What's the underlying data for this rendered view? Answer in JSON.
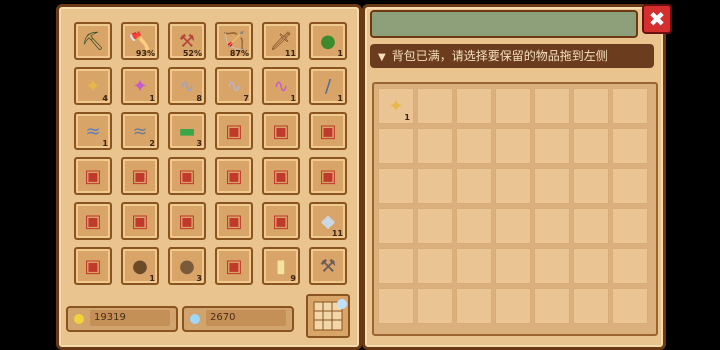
{
  "notice": {
    "text": "背包已满，请选择要保留的物品拖到左侧"
  },
  "close": {
    "symbol": "✖"
  },
  "currency": {
    "gold": "19319",
    "gem": "2670",
    "gold_color": "#f2d23a",
    "gem_color": "#9fd8ff"
  },
  "left_items": [
    {
      "icon": "pickaxe-icon",
      "glyph": "⛏",
      "color": "#2f4a22",
      "count": ""
    },
    {
      "icon": "axe-icon",
      "glyph": "🪓",
      "color": "#c9463a",
      "count": "93%"
    },
    {
      "icon": "hoe-icon",
      "glyph": "⚒",
      "color": "#b4473c",
      "count": "52%"
    },
    {
      "icon": "bow-icon",
      "glyph": "🏹",
      "color": "#b97a3c",
      "count": "87%"
    },
    {
      "icon": "sword-icon",
      "glyph": "🗡",
      "color": "#7a4a22",
      "count": "11"
    },
    {
      "icon": "melon-icon",
      "glyph": "●",
      "color": "#3b8a2c",
      "count": "1"
    },
    {
      "icon": "wand-star-icon",
      "glyph": "✦",
      "color": "#e6b84a",
      "count": "4"
    },
    {
      "icon": "wand-purple-icon",
      "glyph": "✦",
      "color": "#c85ad0",
      "count": "1"
    },
    {
      "icon": "hook-icon",
      "glyph": "∿",
      "color": "#9aa3c8",
      "count": "8"
    },
    {
      "icon": "hook-icon",
      "glyph": "∿",
      "color": "#b6b6d6",
      "count": "7"
    },
    {
      "icon": "hook-star-icon",
      "glyph": "∿",
      "color": "#c85ad0",
      "count": "1"
    },
    {
      "icon": "fish-rod-icon",
      "glyph": "/",
      "color": "#4a6aa0",
      "count": "1"
    },
    {
      "icon": "fish-icon",
      "glyph": "≈",
      "color": "#5c7fc0",
      "count": "1"
    },
    {
      "icon": "fish-icon",
      "glyph": "≈",
      "color": "#6c7e96",
      "count": "2"
    },
    {
      "icon": "soap-icon",
      "glyph": "▬",
      "color": "#3aa64a",
      "count": "3"
    },
    {
      "icon": "chest-icon",
      "glyph": "▣",
      "color": "#c0392b",
      "count": ""
    },
    {
      "icon": "chest-icon",
      "glyph": "▣",
      "color": "#c0392b",
      "count": ""
    },
    {
      "icon": "chest-icon",
      "glyph": "▣",
      "color": "#c0392b",
      "count": ""
    },
    {
      "icon": "chest-icon",
      "glyph": "▣",
      "color": "#c0392b",
      "count": ""
    },
    {
      "icon": "chest-icon",
      "glyph": "▣",
      "color": "#c0392b",
      "count": ""
    },
    {
      "icon": "chest-icon",
      "glyph": "▣",
      "color": "#c0392b",
      "count": ""
    },
    {
      "icon": "chest-icon",
      "glyph": "▣",
      "color": "#c0392b",
      "count": ""
    },
    {
      "icon": "chest-icon",
      "glyph": "▣",
      "color": "#c0392b",
      "count": ""
    },
    {
      "icon": "chest-icon",
      "glyph": "▣",
      "color": "#c0392b",
      "count": ""
    },
    {
      "icon": "chest-icon",
      "glyph": "▣",
      "color": "#c0392b",
      "count": ""
    },
    {
      "icon": "chest-icon",
      "glyph": "▣",
      "color": "#c0392b",
      "count": ""
    },
    {
      "icon": "chest-icon",
      "glyph": "▣",
      "color": "#c0392b",
      "count": ""
    },
    {
      "icon": "chest-icon",
      "glyph": "▣",
      "color": "#c0392b",
      "count": ""
    },
    {
      "icon": "chest-icon",
      "glyph": "▣",
      "color": "#c0392b",
      "count": ""
    },
    {
      "icon": "diamond-icon",
      "glyph": "◆",
      "color": "#c9d8e4",
      "count": "11"
    },
    {
      "icon": "chest-icon",
      "glyph": "▣",
      "color": "#c0392b",
      "count": ""
    },
    {
      "icon": "seed-icon",
      "glyph": "●",
      "color": "#6b4a2a",
      "count": "1"
    },
    {
      "icon": "seed-star-icon",
      "glyph": "●",
      "color": "#7a5a3a",
      "count": "3"
    },
    {
      "icon": "chest-icon",
      "glyph": "▣",
      "color": "#c0392b",
      "count": ""
    },
    {
      "icon": "bottle-icon",
      "glyph": "▮",
      "color": "#f2e4a0",
      "count": "9"
    },
    {
      "icon": "hammer-icon",
      "glyph": "⚒",
      "color": "#6a5a5a",
      "count": ""
    }
  ],
  "right_items": [
    {
      "icon": "wand-star-icon",
      "glyph": "✦",
      "color": "#e6b84a",
      "count": "1"
    }
  ]
}
